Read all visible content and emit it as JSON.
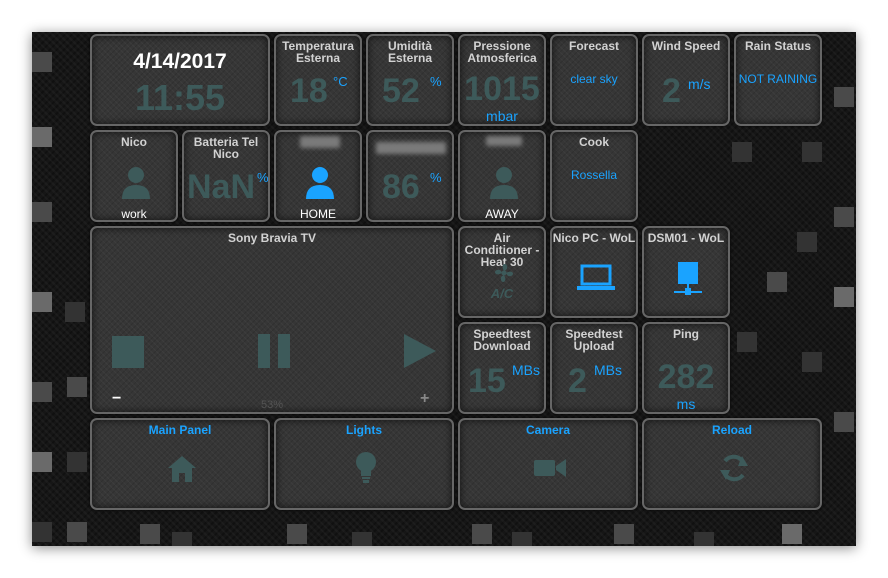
{
  "clock": {
    "date": "4/14/2017",
    "time": "11:55"
  },
  "temp": {
    "title": "Temperatura Esterna",
    "value": "18",
    "unit": "°C"
  },
  "humidity": {
    "title": "Umidità Esterna",
    "value": "52",
    "unit": "%"
  },
  "pressure": {
    "title": "Pressione Atmosferica",
    "value": "1015",
    "unit": "mbar"
  },
  "forecast": {
    "title": "Forecast",
    "value": "clear sky"
  },
  "wind": {
    "title": "Wind Speed",
    "value": "2",
    "unit": "m/s"
  },
  "rain": {
    "title": "Rain Status",
    "value": "NOT RAINING"
  },
  "nico": {
    "title": "Nico",
    "state": "work",
    "icon": "person-icon"
  },
  "battery": {
    "title": "Batteria Tel Nico",
    "value": "NaN",
    "unit": "%"
  },
  "person3": {
    "state": "HOME",
    "icon": "person-icon"
  },
  "sensor4": {
    "value": "86",
    "unit": "%"
  },
  "person5": {
    "state": "AWAY",
    "icon": "person-icon"
  },
  "cook": {
    "title": "Cook",
    "value": "Rossella"
  },
  "tv": {
    "title": "Sony Bravia TV",
    "volume": "53%",
    "volume_fraction": 0.53,
    "minus": "−",
    "plus": "+"
  },
  "ac": {
    "title": "Air Conditioner - Heat 30",
    "label": "A/C",
    "icon": "fan-icon"
  },
  "nicopc": {
    "title": "Nico PC - WoL",
    "icon": "laptop-icon"
  },
  "dsm": {
    "title": "DSM01 - WoL",
    "icon": "server-icon"
  },
  "download": {
    "title": "Speedtest Download",
    "value": "15",
    "unit": "MBs"
  },
  "upload": {
    "title": "Speedtest Upload",
    "value": "2",
    "unit": "MBs"
  },
  "ping": {
    "title": "Ping",
    "value": "282",
    "unit": "ms"
  },
  "nav": [
    {
      "label": "Main Panel",
      "icon": "home-icon"
    },
    {
      "label": "Lights",
      "icon": "bulb-icon"
    },
    {
      "label": "Camera",
      "icon": "video-camera-icon"
    },
    {
      "label": "Reload",
      "icon": "reload-icon"
    }
  ],
  "colors": {
    "accent": "#1aa3ff",
    "dim_value": "#3d5a5a",
    "tile_border": "#666666"
  }
}
